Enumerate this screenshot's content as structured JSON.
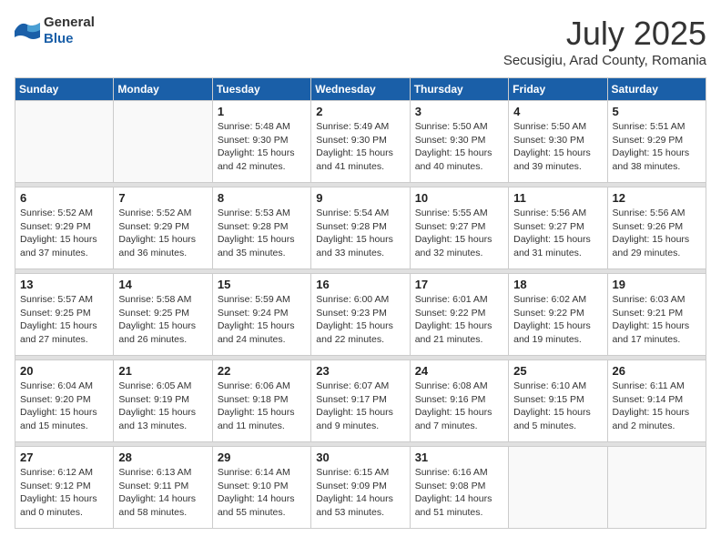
{
  "header": {
    "logo": {
      "text_general": "General",
      "text_blue": "Blue"
    },
    "title": "July 2025",
    "location": "Secusigiu, Arad County, Romania"
  },
  "calendar": {
    "days_of_week": [
      "Sunday",
      "Monday",
      "Tuesday",
      "Wednesday",
      "Thursday",
      "Friday",
      "Saturday"
    ],
    "weeks": [
      [
        {
          "day": "",
          "sunrise": "",
          "sunset": "",
          "daylight": ""
        },
        {
          "day": "",
          "sunrise": "",
          "sunset": "",
          "daylight": ""
        },
        {
          "day": "1",
          "sunrise": "Sunrise: 5:48 AM",
          "sunset": "Sunset: 9:30 PM",
          "daylight": "Daylight: 15 hours and 42 minutes."
        },
        {
          "day": "2",
          "sunrise": "Sunrise: 5:49 AM",
          "sunset": "Sunset: 9:30 PM",
          "daylight": "Daylight: 15 hours and 41 minutes."
        },
        {
          "day": "3",
          "sunrise": "Sunrise: 5:50 AM",
          "sunset": "Sunset: 9:30 PM",
          "daylight": "Daylight: 15 hours and 40 minutes."
        },
        {
          "day": "4",
          "sunrise": "Sunrise: 5:50 AM",
          "sunset": "Sunset: 9:30 PM",
          "daylight": "Daylight: 15 hours and 39 minutes."
        },
        {
          "day": "5",
          "sunrise": "Sunrise: 5:51 AM",
          "sunset": "Sunset: 9:29 PM",
          "daylight": "Daylight: 15 hours and 38 minutes."
        }
      ],
      [
        {
          "day": "6",
          "sunrise": "Sunrise: 5:52 AM",
          "sunset": "Sunset: 9:29 PM",
          "daylight": "Daylight: 15 hours and 37 minutes."
        },
        {
          "day": "7",
          "sunrise": "Sunrise: 5:52 AM",
          "sunset": "Sunset: 9:29 PM",
          "daylight": "Daylight: 15 hours and 36 minutes."
        },
        {
          "day": "8",
          "sunrise": "Sunrise: 5:53 AM",
          "sunset": "Sunset: 9:28 PM",
          "daylight": "Daylight: 15 hours and 35 minutes."
        },
        {
          "day": "9",
          "sunrise": "Sunrise: 5:54 AM",
          "sunset": "Sunset: 9:28 PM",
          "daylight": "Daylight: 15 hours and 33 minutes."
        },
        {
          "day": "10",
          "sunrise": "Sunrise: 5:55 AM",
          "sunset": "Sunset: 9:27 PM",
          "daylight": "Daylight: 15 hours and 32 minutes."
        },
        {
          "day": "11",
          "sunrise": "Sunrise: 5:56 AM",
          "sunset": "Sunset: 9:27 PM",
          "daylight": "Daylight: 15 hours and 31 minutes."
        },
        {
          "day": "12",
          "sunrise": "Sunrise: 5:56 AM",
          "sunset": "Sunset: 9:26 PM",
          "daylight": "Daylight: 15 hours and 29 minutes."
        }
      ],
      [
        {
          "day": "13",
          "sunrise": "Sunrise: 5:57 AM",
          "sunset": "Sunset: 9:25 PM",
          "daylight": "Daylight: 15 hours and 27 minutes."
        },
        {
          "day": "14",
          "sunrise": "Sunrise: 5:58 AM",
          "sunset": "Sunset: 9:25 PM",
          "daylight": "Daylight: 15 hours and 26 minutes."
        },
        {
          "day": "15",
          "sunrise": "Sunrise: 5:59 AM",
          "sunset": "Sunset: 9:24 PM",
          "daylight": "Daylight: 15 hours and 24 minutes."
        },
        {
          "day": "16",
          "sunrise": "Sunrise: 6:00 AM",
          "sunset": "Sunset: 9:23 PM",
          "daylight": "Daylight: 15 hours and 22 minutes."
        },
        {
          "day": "17",
          "sunrise": "Sunrise: 6:01 AM",
          "sunset": "Sunset: 9:22 PM",
          "daylight": "Daylight: 15 hours and 21 minutes."
        },
        {
          "day": "18",
          "sunrise": "Sunrise: 6:02 AM",
          "sunset": "Sunset: 9:22 PM",
          "daylight": "Daylight: 15 hours and 19 minutes."
        },
        {
          "day": "19",
          "sunrise": "Sunrise: 6:03 AM",
          "sunset": "Sunset: 9:21 PM",
          "daylight": "Daylight: 15 hours and 17 minutes."
        }
      ],
      [
        {
          "day": "20",
          "sunrise": "Sunrise: 6:04 AM",
          "sunset": "Sunset: 9:20 PM",
          "daylight": "Daylight: 15 hours and 15 minutes."
        },
        {
          "day": "21",
          "sunrise": "Sunrise: 6:05 AM",
          "sunset": "Sunset: 9:19 PM",
          "daylight": "Daylight: 15 hours and 13 minutes."
        },
        {
          "day": "22",
          "sunrise": "Sunrise: 6:06 AM",
          "sunset": "Sunset: 9:18 PM",
          "daylight": "Daylight: 15 hours and 11 minutes."
        },
        {
          "day": "23",
          "sunrise": "Sunrise: 6:07 AM",
          "sunset": "Sunset: 9:17 PM",
          "daylight": "Daylight: 15 hours and 9 minutes."
        },
        {
          "day": "24",
          "sunrise": "Sunrise: 6:08 AM",
          "sunset": "Sunset: 9:16 PM",
          "daylight": "Daylight: 15 hours and 7 minutes."
        },
        {
          "day": "25",
          "sunrise": "Sunrise: 6:10 AM",
          "sunset": "Sunset: 9:15 PM",
          "daylight": "Daylight: 15 hours and 5 minutes."
        },
        {
          "day": "26",
          "sunrise": "Sunrise: 6:11 AM",
          "sunset": "Sunset: 9:14 PM",
          "daylight": "Daylight: 15 hours and 2 minutes."
        }
      ],
      [
        {
          "day": "27",
          "sunrise": "Sunrise: 6:12 AM",
          "sunset": "Sunset: 9:12 PM",
          "daylight": "Daylight: 15 hours and 0 minutes."
        },
        {
          "day": "28",
          "sunrise": "Sunrise: 6:13 AM",
          "sunset": "Sunset: 9:11 PM",
          "daylight": "Daylight: 14 hours and 58 minutes."
        },
        {
          "day": "29",
          "sunrise": "Sunrise: 6:14 AM",
          "sunset": "Sunset: 9:10 PM",
          "daylight": "Daylight: 14 hours and 55 minutes."
        },
        {
          "day": "30",
          "sunrise": "Sunrise: 6:15 AM",
          "sunset": "Sunset: 9:09 PM",
          "daylight": "Daylight: 14 hours and 53 minutes."
        },
        {
          "day": "31",
          "sunrise": "Sunrise: 6:16 AM",
          "sunset": "Sunset: 9:08 PM",
          "daylight": "Daylight: 14 hours and 51 minutes."
        },
        {
          "day": "",
          "sunrise": "",
          "sunset": "",
          "daylight": ""
        },
        {
          "day": "",
          "sunrise": "",
          "sunset": "",
          "daylight": ""
        }
      ]
    ]
  }
}
